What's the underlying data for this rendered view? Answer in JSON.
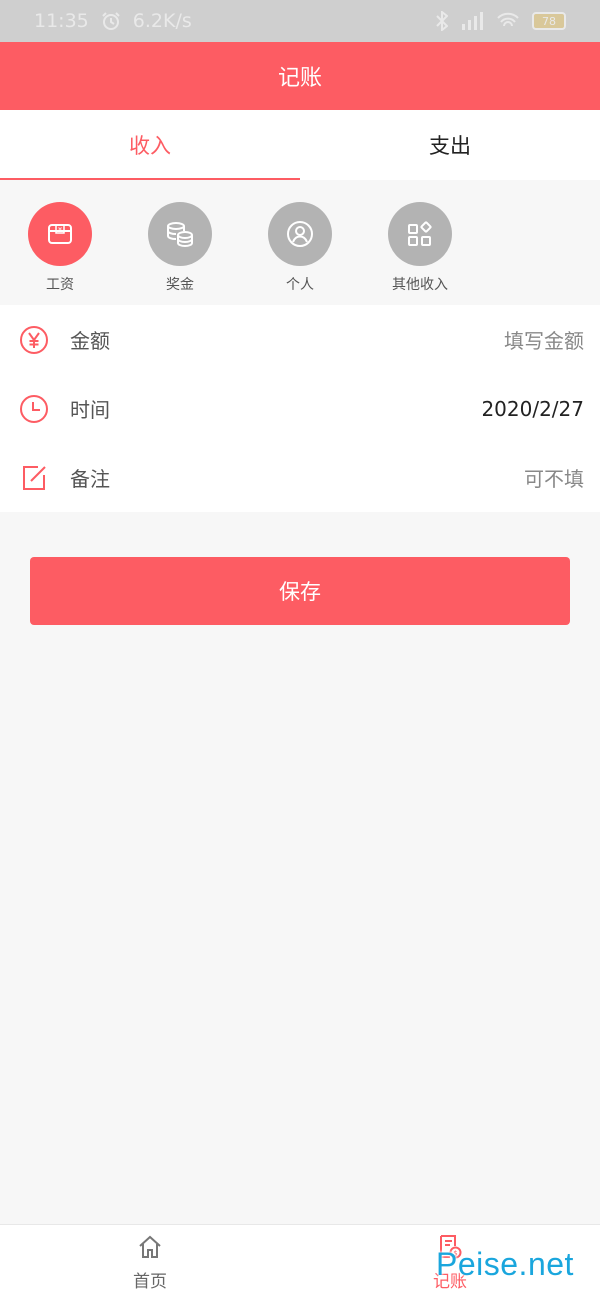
{
  "status_bar": {
    "time": "11:35",
    "network_speed": "6.2K/s",
    "battery": "78"
  },
  "header": {
    "title": "记账"
  },
  "tabs": [
    {
      "label": "收入",
      "active": true
    },
    {
      "label": "支出",
      "active": false
    }
  ],
  "categories": [
    {
      "label": "工资",
      "icon": "wallet-icon",
      "active": true
    },
    {
      "label": "奖金",
      "icon": "coins-icon",
      "active": false
    },
    {
      "label": "个人",
      "icon": "person-icon",
      "active": false
    },
    {
      "label": "其他收入",
      "icon": "apps-icon",
      "active": false
    }
  ],
  "form": {
    "amount": {
      "label": "金额",
      "placeholder": "填写金额",
      "icon": "yen-icon"
    },
    "time": {
      "label": "时间",
      "value": "2020/2/27",
      "icon": "clock-icon"
    },
    "note": {
      "label": "备注",
      "placeholder": "可不填",
      "icon": "edit-icon"
    }
  },
  "save_button": {
    "label": "保存"
  },
  "bottom_nav": [
    {
      "label": "首页",
      "icon": "home-icon",
      "active": false
    },
    {
      "label": "记账",
      "icon": "bill-icon",
      "active": true
    }
  ],
  "watermark": "Peise.net",
  "colors": {
    "accent": "#fd5c63",
    "inactive_circle": "#b3b3b3",
    "background": "#f7f7f7"
  }
}
